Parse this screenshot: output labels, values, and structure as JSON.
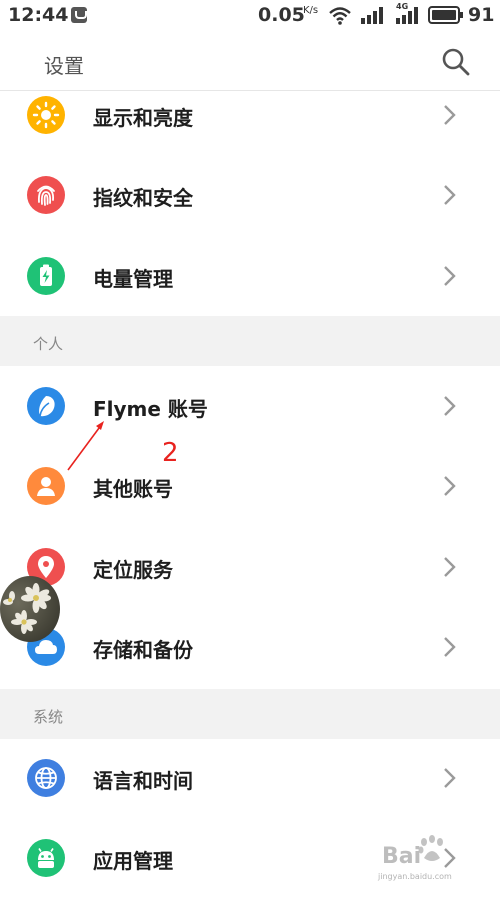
{
  "status_bar": {
    "time": "12:44",
    "net_speed": "0.05",
    "net_speed_unit": "K/s",
    "signal2_label": "4G",
    "battery": "91"
  },
  "header": {
    "title": "设置",
    "search_icon": "search-icon"
  },
  "rows_top": [
    {
      "label": "显示和亮度",
      "icon": "sun-icon",
      "color": "#FFB300"
    },
    {
      "label": "指纹和安全",
      "icon": "fingerprint-icon",
      "color": "#EF4F4F"
    },
    {
      "label": "电量管理",
      "icon": "battery-icon",
      "color": "#1FC276"
    }
  ],
  "section_personal": {
    "label": "个人"
  },
  "rows_personal": [
    {
      "label": "Flyme 账号",
      "icon": "flyme-icon",
      "color": "#2B8AE6"
    },
    {
      "label": "其他账号",
      "icon": "person-icon",
      "color": "#FF8A3C"
    },
    {
      "label": "定位服务",
      "icon": "location-pin-icon",
      "color": "#EF4F4F"
    },
    {
      "label": "存储和备份",
      "icon": "cloud-icon",
      "color": "#2B8AE6"
    }
  ],
  "section_system": {
    "label": "系统"
  },
  "rows_system": [
    {
      "label": "语言和时间",
      "icon": "globe-icon",
      "color": "#3F7FE0"
    },
    {
      "label": "应用管理",
      "icon": "android-icon",
      "color": "#1FC276"
    }
  ],
  "annotation": {
    "number": "2",
    "color": "#E8231F"
  },
  "watermark": {
    "text": "Bai",
    "subtext": "jingyan.baidu.com"
  }
}
